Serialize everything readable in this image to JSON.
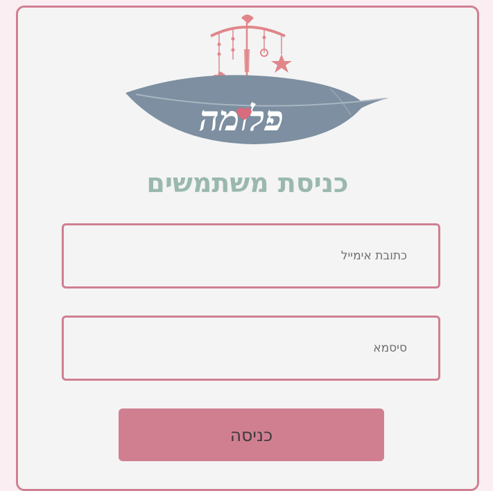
{
  "logo": {
    "text": "פלומה",
    "feather_color": "#7d8fa0",
    "mobile_color": "#e0868a",
    "heart_color": "#d96b7e"
  },
  "login": {
    "title": "כניסת משתמשים",
    "email_placeholder": "כתובת אימייל",
    "password_placeholder": "סיסמא",
    "submit_label": "כניסה"
  },
  "colors": {
    "background": "#fbeef3",
    "card_border": "#d07f91",
    "title": "#9ab8ae",
    "button": "#d07f91"
  }
}
